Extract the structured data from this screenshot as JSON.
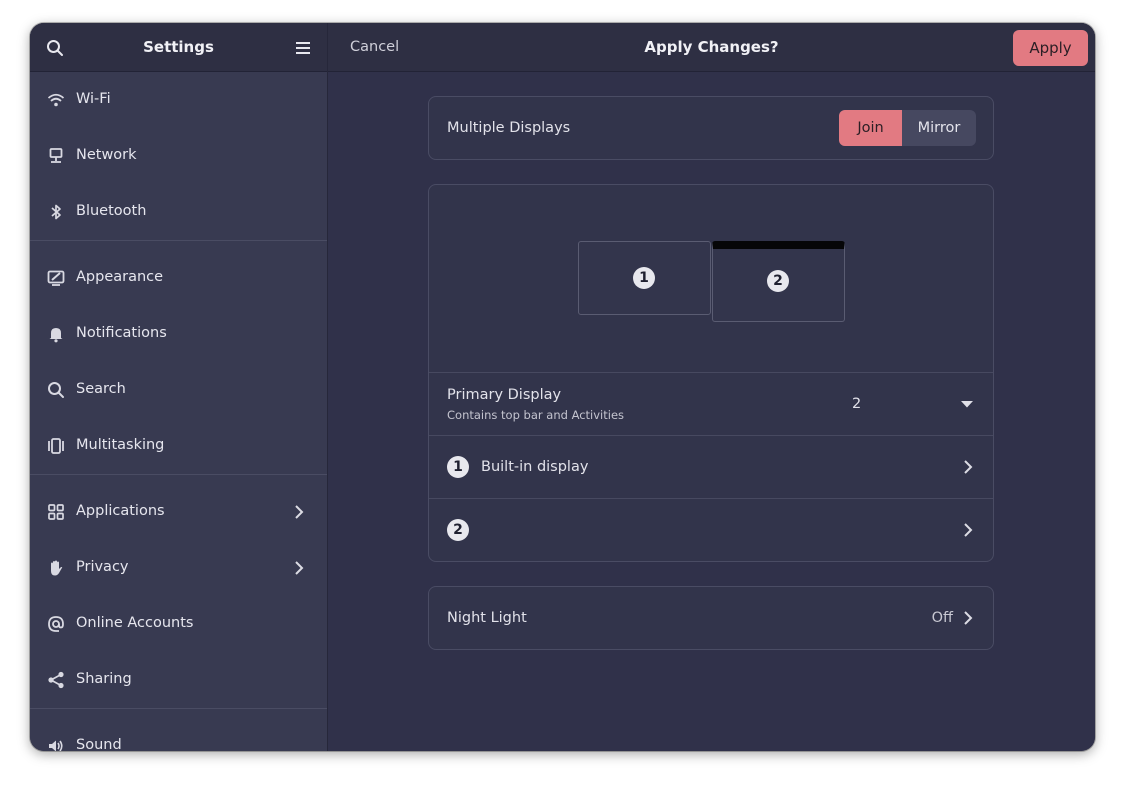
{
  "sidebar": {
    "title": "Settings",
    "groups": [
      [
        {
          "label": "Wi-Fi",
          "icon": "wifi-icon"
        },
        {
          "label": "Network",
          "icon": "network-icon"
        },
        {
          "label": "Bluetooth",
          "icon": "bluetooth-icon"
        }
      ],
      [
        {
          "label": "Appearance",
          "icon": "appearance-icon"
        },
        {
          "label": "Notifications",
          "icon": "bell-icon"
        },
        {
          "label": "Search",
          "icon": "search-icon"
        },
        {
          "label": "Multitasking",
          "icon": "multitasking-icon"
        }
      ],
      [
        {
          "label": "Applications",
          "icon": "grid-icon",
          "chevron": true
        },
        {
          "label": "Privacy",
          "icon": "hand-icon",
          "chevron": true
        },
        {
          "label": "Online Accounts",
          "icon": "at-icon"
        },
        {
          "label": "Sharing",
          "icon": "share-icon"
        }
      ],
      [
        {
          "label": "Sound",
          "icon": "speaker-icon"
        }
      ]
    ]
  },
  "header": {
    "cancel_label": "Cancel",
    "title": "Apply Changes?",
    "apply_label": "Apply"
  },
  "displays": {
    "multiple_label": "Multiple Displays",
    "join_label": "Join",
    "mirror_label": "Mirror",
    "mode_selected": "Join",
    "monitor_1": "1",
    "monitor_2": "2",
    "primary_label": "Primary Display",
    "primary_sublabel": "Contains top bar and Activities",
    "primary_value": "2",
    "display_rows": [
      {
        "number": "1",
        "label": "Built-in display"
      },
      {
        "number": "2",
        "label": ""
      }
    ]
  },
  "night_light": {
    "label": "Night Light",
    "value": "Off"
  },
  "colors": {
    "accent": "#e27a82",
    "window_bg": "#30314a",
    "sidebar_bg": "#383a51"
  }
}
